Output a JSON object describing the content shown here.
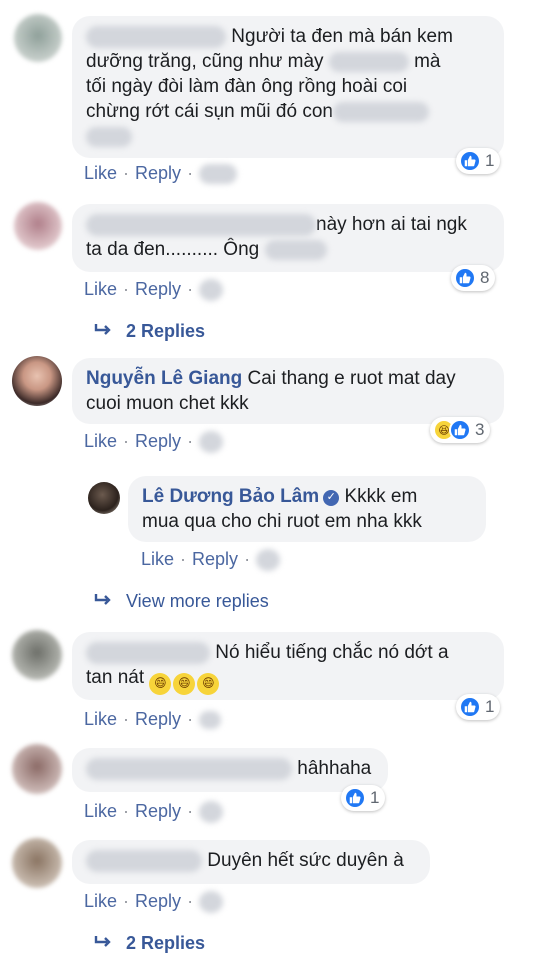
{
  "actions": {
    "like": "Like",
    "reply": "Reply",
    "separator": "·"
  },
  "comments": [
    {
      "lines": [
        "Người ta đen mà bán kem",
        "dưỡng trăng, cũng như mày",
        "tối ngày đòi làm đàn ông rồng hoài coi",
        "chừng rớt cái sụn mũi đó con"
      ],
      "line2_suffix": "mà",
      "reactions": {
        "count": "1"
      }
    },
    {
      "lines": [
        "này hơn ai tai ngk",
        "ta da đen.......... Ông"
      ],
      "reactions": {
        "count": "8"
      },
      "replies_label": "2 Replies"
    },
    {
      "author": "Nguyễn Lê Giang",
      "lines": [
        "Cai thang e ruot mat day",
        "cuoi muon chet kkk"
      ],
      "reactions": {
        "count": "3"
      },
      "reply": {
        "author": "Lê Dương Bảo Lâm",
        "lines": [
          "Kkkk em",
          "mua qua cho chi ruot em nha kkk"
        ]
      },
      "more_replies_label": "View more replies"
    },
    {
      "lines": [
        "Nó hiểu tiếng chắc nó dớt a",
        "tan nát"
      ],
      "reactions": {
        "count": "1"
      }
    },
    {
      "lines": [
        "hâhhaha"
      ],
      "reactions": {
        "count": "1"
      }
    },
    {
      "lines": [
        "Duyên hết sức duyên à"
      ],
      "replies_label": "2 Replies"
    }
  ],
  "colors": {
    "link": "#385898",
    "action": "#4b67a1",
    "bubble": "#f2f3f5",
    "like": "#2078f4"
  }
}
